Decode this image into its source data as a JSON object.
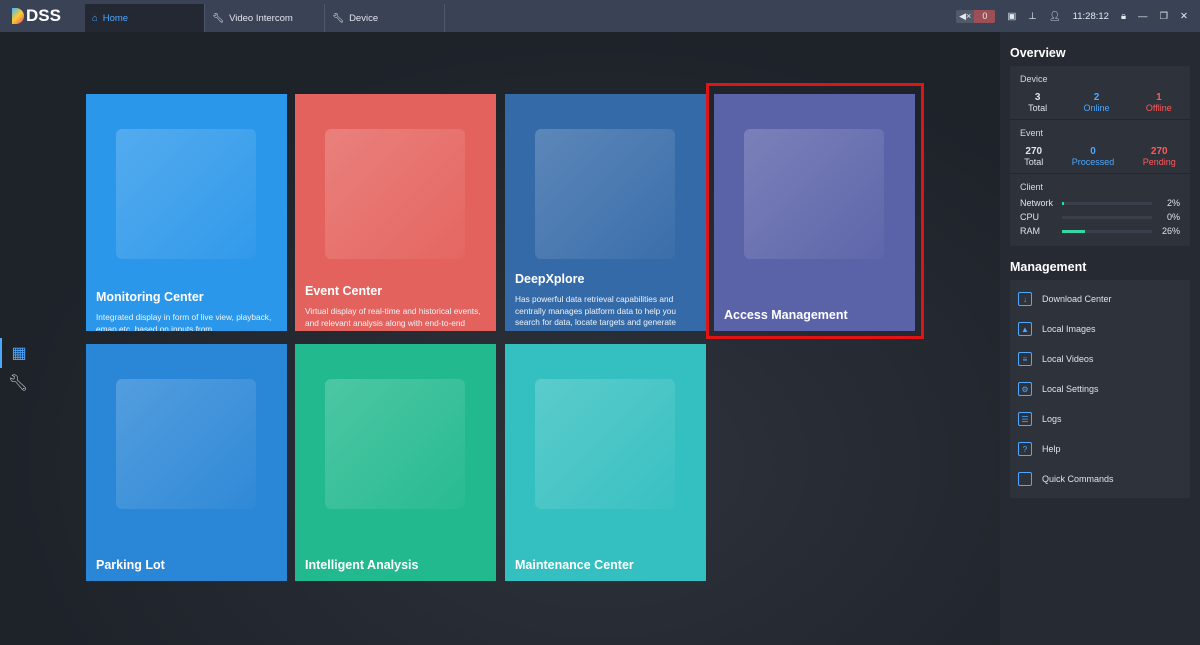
{
  "app": {
    "logo": "DSS"
  },
  "tabs": [
    {
      "label": "Home",
      "icon": "home-icon"
    },
    {
      "label": "Video Intercom",
      "icon": "wrench-icon"
    },
    {
      "label": "Device",
      "icon": "wrench-icon"
    }
  ],
  "status": {
    "alarm_count": "0",
    "time": "11:28:12"
  },
  "cards": [
    {
      "title": "Monitoring Center",
      "desc": "Integrated display in form of live view, playback, emap etc. based on inputs from",
      "color": "#2b97ea"
    },
    {
      "title": "Event Center",
      "desc": "Virtual display of real-time and historical events, and relevant analysis along with end-to-end alarm event processing",
      "color": "#e4625d"
    },
    {
      "title": "DeepXplore",
      "desc": "Has powerful data retrieval capabilities and centrally manages platform data to help you search for data, locate targets and generate",
      "color": "#356aa8"
    },
    {
      "title": "Access Management",
      "desc": "",
      "color": "#5a62a8"
    },
    {
      "title": "Parking Lot",
      "desc": "",
      "color": "#2a86d6"
    },
    {
      "title": "Intelligent Analysis",
      "desc": "",
      "color": "#22b98e"
    },
    {
      "title": "Maintenance Center",
      "desc": "",
      "color": "#34bfc0"
    }
  ],
  "overview": {
    "title": "Overview",
    "device": {
      "label": "Device",
      "total": "3",
      "total_label": "Total",
      "online": "2",
      "online_label": "Online",
      "offline": "1",
      "offline_label": "Offline"
    },
    "event": {
      "label": "Event",
      "total": "270",
      "total_label": "Total",
      "processed": "0",
      "processed_label": "Processed",
      "pending": "270",
      "pending_label": "Pending"
    },
    "client": {
      "label": "Client",
      "metrics": [
        {
          "name": "Network",
          "value": "2%",
          "pct": 2
        },
        {
          "name": "CPU",
          "value": "0%",
          "pct": 0
        },
        {
          "name": "RAM",
          "value": "26%",
          "pct": 26
        }
      ]
    }
  },
  "management": {
    "title": "Management",
    "items": [
      {
        "label": "Download Center",
        "icon": "download-icon"
      },
      {
        "label": "Local Images",
        "icon": "image-icon"
      },
      {
        "label": "Local Videos",
        "icon": "video-icon"
      },
      {
        "label": "Local Settings",
        "icon": "settings-icon"
      },
      {
        "label": "Logs",
        "icon": "logs-icon"
      },
      {
        "label": "Help",
        "icon": "help-icon"
      },
      {
        "label": "Quick Commands",
        "icon": "code-icon"
      }
    ]
  },
  "colors": {
    "accent": "#4ea7ff",
    "online": "#4ea7ff",
    "offline": "#ff5a5a",
    "highlight": "#e01414"
  }
}
